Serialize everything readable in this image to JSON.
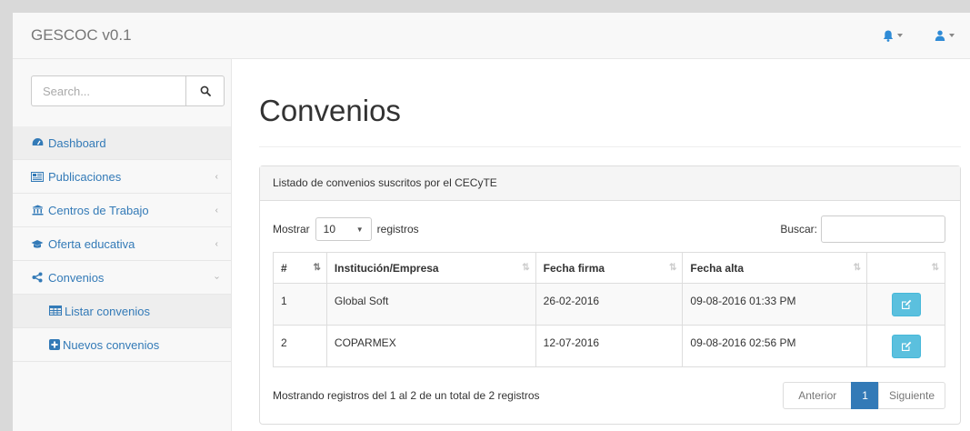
{
  "app": {
    "brand": "GESCOC v0.1"
  },
  "navbar": {
    "bell_icon": "bell-icon",
    "user_icon": "user-icon"
  },
  "sidebar": {
    "search": {
      "placeholder": "Search..."
    },
    "items": [
      {
        "label": "Dashboard",
        "icon": "dashboard-icon",
        "has_chevron": false
      },
      {
        "label": "Publicaciones",
        "icon": "newspaper-icon",
        "has_chevron": true
      },
      {
        "label": "Centros de Trabajo",
        "icon": "institution-icon",
        "has_chevron": true
      },
      {
        "label": "Oferta educativa",
        "icon": "graduation-cap-icon",
        "has_chevron": true
      },
      {
        "label": "Convenios",
        "icon": "share-icon",
        "has_chevron": true,
        "expanded": true
      }
    ],
    "subitems": [
      {
        "label": "Listar convenios",
        "icon": "table-icon"
      },
      {
        "label": "Nuevos convenios",
        "icon": "plus-square-icon"
      }
    ]
  },
  "main": {
    "title": "Convenios",
    "panel": {
      "heading": "Listado de convenios suscritos por el CECyTE",
      "length": {
        "prefix": "Mostrar",
        "value": "10",
        "suffix": "registros"
      },
      "filter": {
        "label": "Buscar:",
        "value": ""
      },
      "columns": [
        "#",
        "Institución/Empresa",
        "Fecha firma",
        "Fecha alta",
        ""
      ],
      "rows": [
        {
          "num": "1",
          "institucion": "Global Soft",
          "fecha_firma": "26-02-2016",
          "fecha_alta": "09-08-2016 01:33 PM"
        },
        {
          "num": "2",
          "institucion": "COPARMEX",
          "fecha_firma": "12-07-2016",
          "fecha_alta": "09-08-2016 02:56 PM"
        }
      ],
      "info": "Mostrando registros del 1 al 2 de un total de 2 registros",
      "pagination": {
        "previous": "Anterior",
        "current": "1",
        "next": "Siguiente"
      }
    }
  },
  "colors": {
    "link": "#337ab7",
    "edit_button": "#5bc0de",
    "pager_active": "#337ab7"
  }
}
